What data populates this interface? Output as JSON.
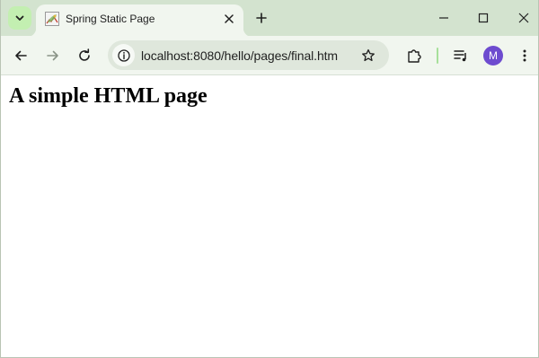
{
  "browser": {
    "tab": {
      "title": "Spring Static Page",
      "favicon": "spring-leaf-icon"
    },
    "address_bar": {
      "host": "localhost",
      "rest": ":8080/hello/pages/final.htm"
    },
    "profile_initial": "M",
    "icons": {
      "tab_search": "chevron-down-icon",
      "close_tab": "close-icon",
      "new_tab": "plus-icon",
      "minimize": "minimize-icon",
      "maximize": "maximize-icon",
      "close_window": "close-icon",
      "back": "arrow-left-icon",
      "forward": "arrow-right-icon",
      "reload": "reload-icon",
      "site_info": "info-icon",
      "bookmark": "star-icon",
      "extensions": "puzzle-icon",
      "media": "media-control-icon",
      "menu": "kebab-menu-icon"
    },
    "colors": {
      "tabstrip": "#d3e3cf",
      "toolbar": "#f1f6ef",
      "avatar": "#6d4bcf"
    }
  },
  "page": {
    "heading": "A simple HTML page"
  }
}
